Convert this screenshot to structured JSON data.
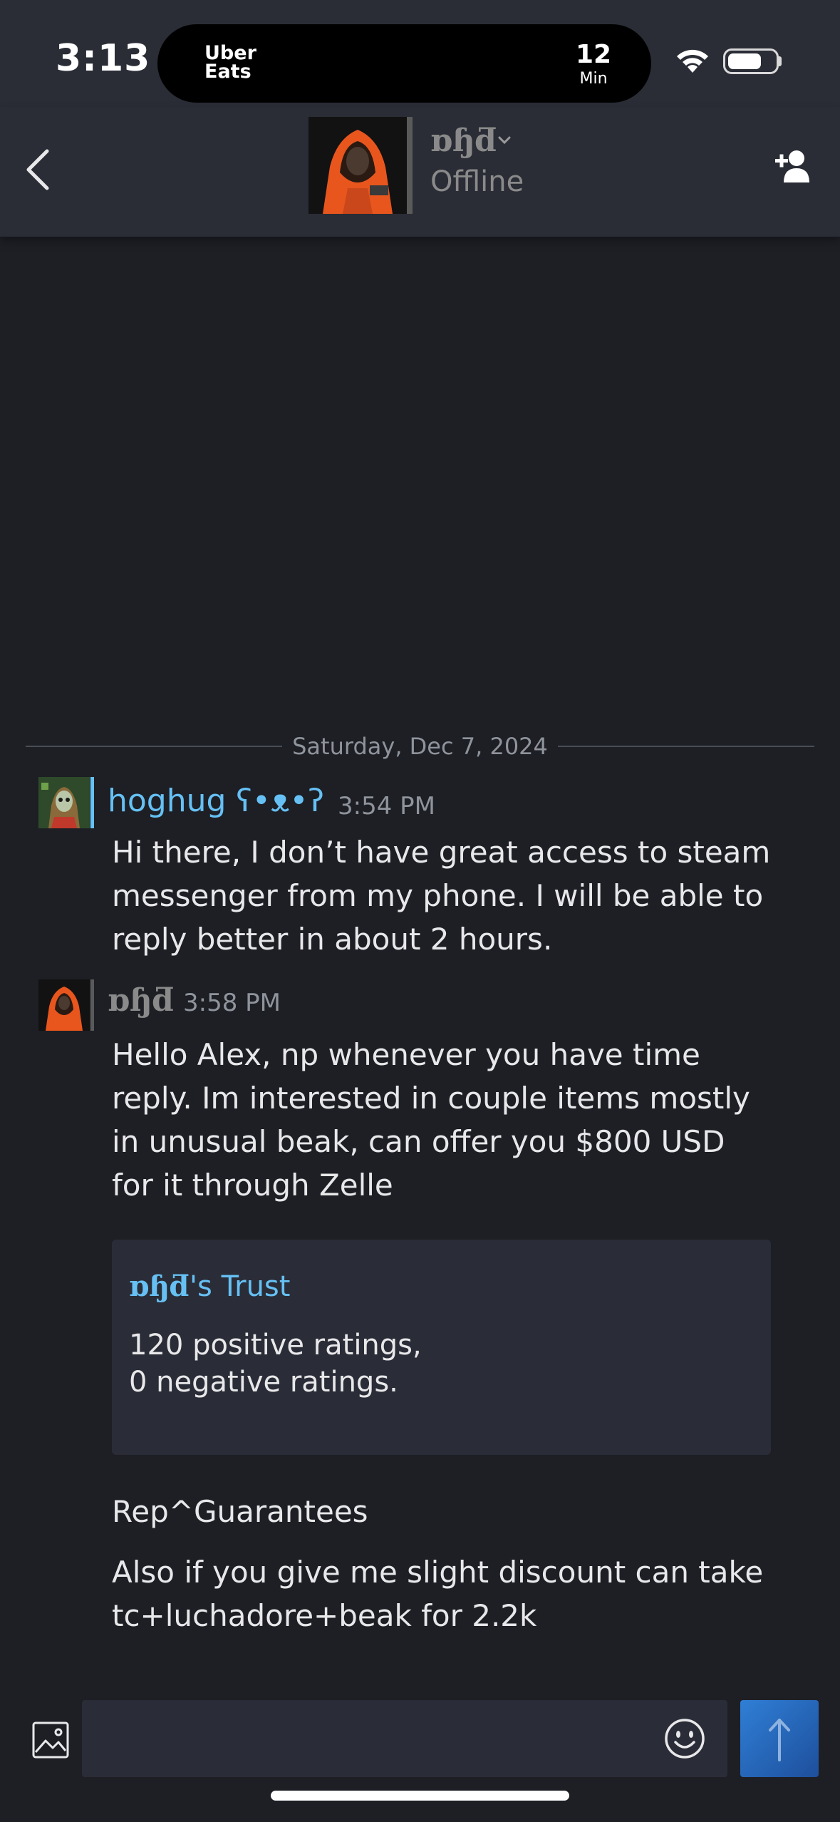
{
  "status_bar": {
    "time": "3:13",
    "live_activity": {
      "app": [
        "Uber",
        "Eats"
      ],
      "eta_value": "12",
      "eta_unit": "Min"
    },
    "icons": [
      "wifi-icon",
      "battery-icon"
    ]
  },
  "header": {
    "contact_name": "ɒɧƌ",
    "status": "Offline",
    "icons": [
      "back-chevron-icon",
      "chevron-down-icon",
      "add-friend-icon"
    ]
  },
  "chat": {
    "date_divider": "Saturday, Dec 7, 2024",
    "messages": [
      {
        "sender": "hoghug ʕ•ᴥ•ʔ",
        "time": "3:54 PM",
        "sender_color": "#66c0f4",
        "lines": [
          "Hi there, I don’t have great access to steam",
          "messenger from my phone. I will be able to",
          "reply better in about 2 hours."
        ]
      },
      {
        "sender": "ɒɧƌ",
        "time": "3:58 PM",
        "sender_color": "#8a8a8a",
        "lines": [
          "Hello Alex, np whenever you have time",
          "reply. Im interested in couple items mostly",
          "in unusual beak, can offer you $800 USD",
          "for it through Zelle"
        ],
        "embed": {
          "name": "ɒɧƌ",
          "title_suffix": "'s Trust",
          "line1": "120 positive ratings,",
          "line2": "0 negative ratings."
        },
        "after": [
          "Rep^Guarantees"
        ],
        "after2": [
          "Also if you give me slight discount can take",
          "tc+luchadore+beak for 2.2k"
        ]
      }
    ]
  },
  "composer": {
    "placeholder": "",
    "icons": [
      "image-icon",
      "emoji-icon",
      "send-arrow-icon"
    ]
  },
  "colors": {
    "background": "#1d1f25",
    "header": "#2a2d36",
    "accent": "#66c0f4",
    "send_button": "#2f7fd6"
  }
}
